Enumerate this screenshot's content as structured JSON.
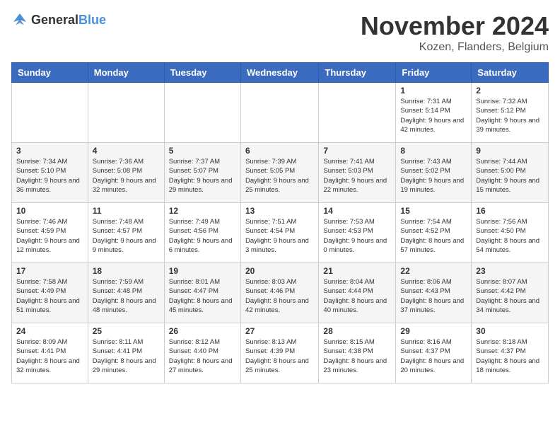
{
  "logo": {
    "general": "General",
    "blue": "Blue"
  },
  "title": "November 2024",
  "location": "Kozen, Flanders, Belgium",
  "days_header": [
    "Sunday",
    "Monday",
    "Tuesday",
    "Wednesday",
    "Thursday",
    "Friday",
    "Saturday"
  ],
  "weeks": [
    [
      {
        "day": "",
        "info": ""
      },
      {
        "day": "",
        "info": ""
      },
      {
        "day": "",
        "info": ""
      },
      {
        "day": "",
        "info": ""
      },
      {
        "day": "",
        "info": ""
      },
      {
        "day": "1",
        "info": "Sunrise: 7:31 AM\nSunset: 5:14 PM\nDaylight: 9 hours and 42 minutes."
      },
      {
        "day": "2",
        "info": "Sunrise: 7:32 AM\nSunset: 5:12 PM\nDaylight: 9 hours and 39 minutes."
      }
    ],
    [
      {
        "day": "3",
        "info": "Sunrise: 7:34 AM\nSunset: 5:10 PM\nDaylight: 9 hours and 36 minutes."
      },
      {
        "day": "4",
        "info": "Sunrise: 7:36 AM\nSunset: 5:08 PM\nDaylight: 9 hours and 32 minutes."
      },
      {
        "day": "5",
        "info": "Sunrise: 7:37 AM\nSunset: 5:07 PM\nDaylight: 9 hours and 29 minutes."
      },
      {
        "day": "6",
        "info": "Sunrise: 7:39 AM\nSunset: 5:05 PM\nDaylight: 9 hours and 25 minutes."
      },
      {
        "day": "7",
        "info": "Sunrise: 7:41 AM\nSunset: 5:03 PM\nDaylight: 9 hours and 22 minutes."
      },
      {
        "day": "8",
        "info": "Sunrise: 7:43 AM\nSunset: 5:02 PM\nDaylight: 9 hours and 19 minutes."
      },
      {
        "day": "9",
        "info": "Sunrise: 7:44 AM\nSunset: 5:00 PM\nDaylight: 9 hours and 15 minutes."
      }
    ],
    [
      {
        "day": "10",
        "info": "Sunrise: 7:46 AM\nSunset: 4:59 PM\nDaylight: 9 hours and 12 minutes."
      },
      {
        "day": "11",
        "info": "Sunrise: 7:48 AM\nSunset: 4:57 PM\nDaylight: 9 hours and 9 minutes."
      },
      {
        "day": "12",
        "info": "Sunrise: 7:49 AM\nSunset: 4:56 PM\nDaylight: 9 hours and 6 minutes."
      },
      {
        "day": "13",
        "info": "Sunrise: 7:51 AM\nSunset: 4:54 PM\nDaylight: 9 hours and 3 minutes."
      },
      {
        "day": "14",
        "info": "Sunrise: 7:53 AM\nSunset: 4:53 PM\nDaylight: 9 hours and 0 minutes."
      },
      {
        "day": "15",
        "info": "Sunrise: 7:54 AM\nSunset: 4:52 PM\nDaylight: 8 hours and 57 minutes."
      },
      {
        "day": "16",
        "info": "Sunrise: 7:56 AM\nSunset: 4:50 PM\nDaylight: 8 hours and 54 minutes."
      }
    ],
    [
      {
        "day": "17",
        "info": "Sunrise: 7:58 AM\nSunset: 4:49 PM\nDaylight: 8 hours and 51 minutes."
      },
      {
        "day": "18",
        "info": "Sunrise: 7:59 AM\nSunset: 4:48 PM\nDaylight: 8 hours and 48 minutes."
      },
      {
        "day": "19",
        "info": "Sunrise: 8:01 AM\nSunset: 4:47 PM\nDaylight: 8 hours and 45 minutes."
      },
      {
        "day": "20",
        "info": "Sunrise: 8:03 AM\nSunset: 4:46 PM\nDaylight: 8 hours and 42 minutes."
      },
      {
        "day": "21",
        "info": "Sunrise: 8:04 AM\nSunset: 4:44 PM\nDaylight: 8 hours and 40 minutes."
      },
      {
        "day": "22",
        "info": "Sunrise: 8:06 AM\nSunset: 4:43 PM\nDaylight: 8 hours and 37 minutes."
      },
      {
        "day": "23",
        "info": "Sunrise: 8:07 AM\nSunset: 4:42 PM\nDaylight: 8 hours and 34 minutes."
      }
    ],
    [
      {
        "day": "24",
        "info": "Sunrise: 8:09 AM\nSunset: 4:41 PM\nDaylight: 8 hours and 32 minutes."
      },
      {
        "day": "25",
        "info": "Sunrise: 8:11 AM\nSunset: 4:41 PM\nDaylight: 8 hours and 29 minutes."
      },
      {
        "day": "26",
        "info": "Sunrise: 8:12 AM\nSunset: 4:40 PM\nDaylight: 8 hours and 27 minutes."
      },
      {
        "day": "27",
        "info": "Sunrise: 8:13 AM\nSunset: 4:39 PM\nDaylight: 8 hours and 25 minutes."
      },
      {
        "day": "28",
        "info": "Sunrise: 8:15 AM\nSunset: 4:38 PM\nDaylight: 8 hours and 23 minutes."
      },
      {
        "day": "29",
        "info": "Sunrise: 8:16 AM\nSunset: 4:37 PM\nDaylight: 8 hours and 20 minutes."
      },
      {
        "day": "30",
        "info": "Sunrise: 8:18 AM\nSunset: 4:37 PM\nDaylight: 8 hours and 18 minutes."
      }
    ]
  ]
}
